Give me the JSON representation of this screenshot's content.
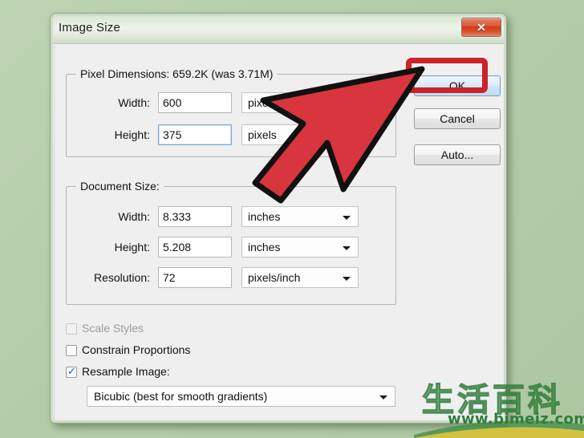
{
  "desktop": {
    "background_color": "#b7cfab"
  },
  "dialog": {
    "title": "Image Size",
    "close_icon": "close-x-icon",
    "close_glyph": "✕",
    "pixel_dimensions": {
      "group_title": "Pixel Dimensions:  659.2K (was 3.71M)",
      "fields": [
        {
          "label": "Width:",
          "value": "600",
          "unit": "pixels",
          "focused": false
        },
        {
          "label": "Height:",
          "value": "375",
          "unit": "pixels",
          "focused": true
        }
      ]
    },
    "document_size": {
      "group_title": "Document Size:",
      "fields": [
        {
          "label": "Width:",
          "value": "8.333",
          "unit": "inches",
          "focused": false
        },
        {
          "label": "Height:",
          "value": "5.208",
          "unit": "inches",
          "focused": false
        },
        {
          "label": "Resolution:",
          "value": "72",
          "unit": "pixels/inch",
          "focused": false
        }
      ]
    },
    "options": [
      {
        "label": "Scale Styles",
        "checked": false,
        "disabled": true
      },
      {
        "label": "Constrain Proportions",
        "checked": false,
        "disabled": false
      },
      {
        "label": "Resample Image:",
        "checked": true,
        "disabled": false
      }
    ],
    "resample_method": "Bicubic (best for smooth gradients)",
    "buttons": [
      {
        "name": "ok",
        "label": "OK",
        "default": true
      },
      {
        "name": "cancel",
        "label": "Cancel",
        "default": false
      },
      {
        "name": "auto",
        "label": "Auto...",
        "default": false
      }
    ]
  },
  "annotation": {
    "cursor_icon": "red-arrow-cursor",
    "cursor_color": "#d8353e",
    "highlight_color": "#cc2229",
    "highlight_target": "OK"
  },
  "watermark": {
    "text_cn": "生活百科",
    "url": "www.bimeiz.com",
    "color": "#2f7d3a"
  }
}
